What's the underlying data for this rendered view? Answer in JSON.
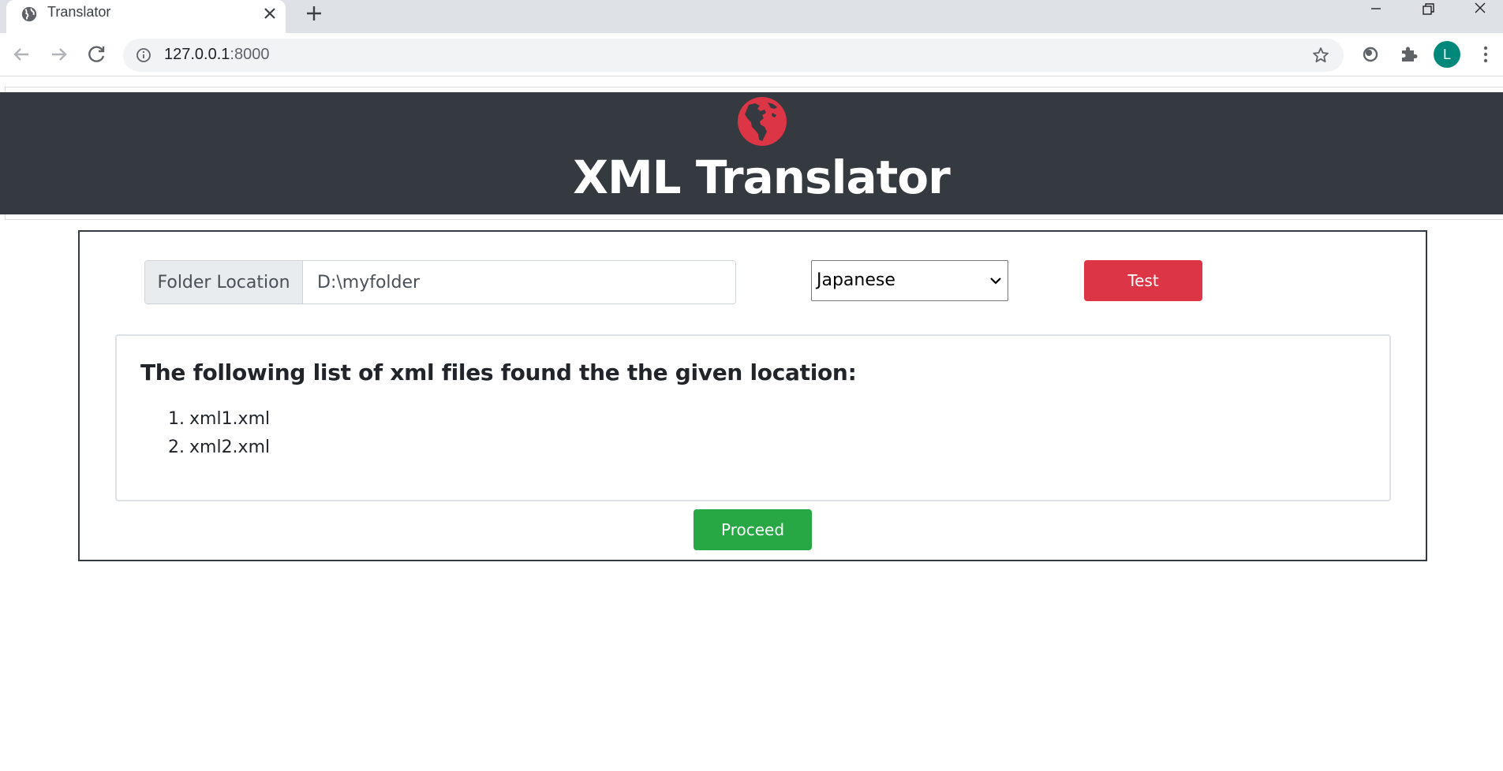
{
  "browser": {
    "tab_title": "Translator",
    "url_host": "127.0.0.1",
    "url_port": ":8000",
    "profile_initial": "L"
  },
  "icons": {
    "favicon": "globe-icon",
    "logo": "globe-americas-icon",
    "select_arrow": "chevron-down-icon"
  },
  "colors": {
    "header_bg": "#343a40",
    "logo": "#dc3545",
    "test_button": "#dc3545",
    "proceed_button": "#28a745",
    "avatar": "#00897b"
  },
  "header": {
    "title": "XML Translator"
  },
  "form": {
    "folder_label": "Folder Location",
    "folder_value": "D:\\myfolder",
    "language_selected": "Japanese",
    "test_label": "Test"
  },
  "results": {
    "heading": "The following list of xml files found the the given location:",
    "files": [
      {
        "num": "1.",
        "name": "xml1.xml"
      },
      {
        "num": "2.",
        "name": "xml2.xml"
      }
    ]
  },
  "actions": {
    "proceed_label": "Proceed"
  }
}
